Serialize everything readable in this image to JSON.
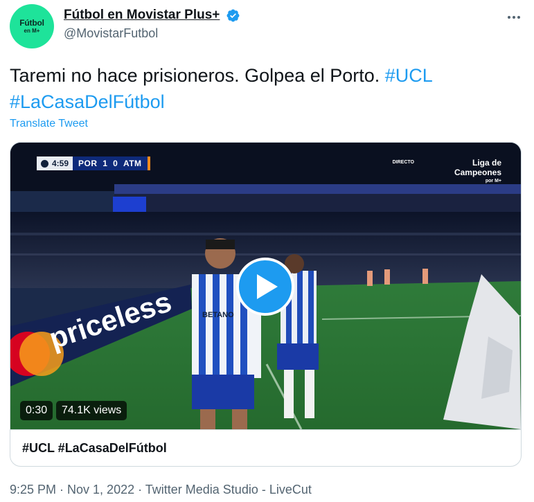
{
  "author": {
    "display_name": "Fútbol en Movistar Plus+",
    "handle": "@MovistarFutbol",
    "avatar_line1": "Fútbol",
    "avatar_line2": "en M+",
    "verified": true
  },
  "tweet": {
    "text_plain": "Taremi no hace prisioneros. Golpea el Porto. ",
    "hashtag_1": "#UCL",
    "hashtag_2": "#LaCasaDelFútbol",
    "translate_label": "Translate Tweet"
  },
  "media": {
    "duration": "0:30",
    "views": "74.1K views",
    "card_title": "#UCL #LaCasaDelFútbol",
    "overlay": {
      "clock": "4:59",
      "team_home": "POR",
      "score_home": "1",
      "score_away": "0",
      "team_away": "ATM",
      "broadcast_live": "DIRECTO",
      "broadcast_line1": "Liga de",
      "broadcast_line2": "Campeones",
      "broadcast_by": "por M+",
      "ad_text": "priceless",
      "shirt_sponsor": "BETANO"
    }
  },
  "meta": {
    "timestamp": "9:25 PM · Nov 1, 2022 · Twitter Media Studio - LiveCut"
  },
  "colors": {
    "accent": "#1d9bf0",
    "text": "#0f1419",
    "muted": "#536471",
    "border": "#cfd9de",
    "avatar_bg": "#1ee39a"
  }
}
